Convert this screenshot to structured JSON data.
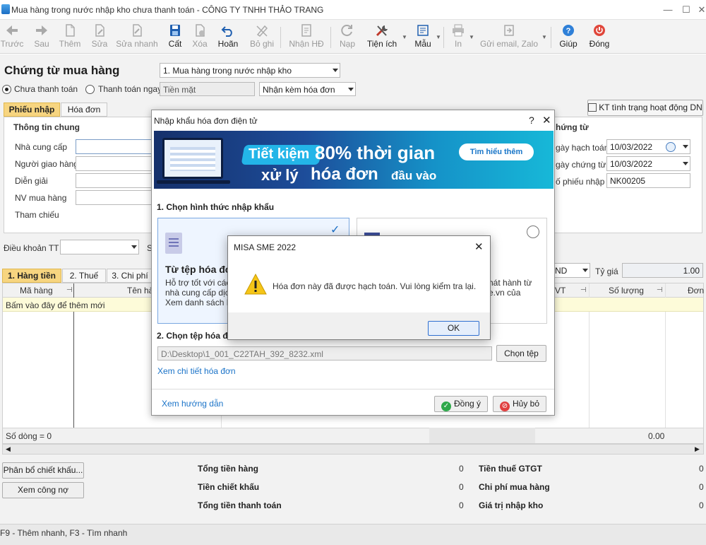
{
  "window": {
    "title": "Mua hàng trong nước nhập kho chưa thanh toán - CÔNG TY TNHH THẢO TRANG"
  },
  "toolbar": {
    "back": "Trước",
    "next": "Sau",
    "add": "Thêm",
    "edit": "Sửa",
    "quick_edit": "Sửa nhanh",
    "save": "Cất",
    "delete": "Xóa",
    "undo": "Hoãn",
    "unpost": "Bỏ ghi",
    "receive_invoice": "Nhận HĐ",
    "load": "Nạp",
    "utilities": "Tiện ích",
    "template": "Mẫu",
    "print": "In",
    "send": "Gửi email, Zalo",
    "help": "Giúp",
    "close": "Đóng"
  },
  "form": {
    "heading": "Chứng từ mua hàng",
    "type_select": "1. Mua hàng trong nước nhập kho",
    "radio_unpaid": "Chưa thanh toán",
    "radio_paid": "Thanh toán ngay",
    "payment_method": "Tiền mặt",
    "invoice_mode": "Nhận kèm hóa đơn",
    "tab_receipt": "Phiếu nhập",
    "tab_invoice": "Hóa đơn",
    "kt_button": "KT tình trạng hoạt động DN",
    "general_info": "Thông tin chung",
    "supplier": "Nhà cung cấp",
    "deliverer": "Người giao hàng",
    "description": "Diễn giải",
    "purchaser": "NV mua hàng",
    "reference": "Tham chiếu",
    "voucher_group": "Chứng từ",
    "voucher_group_visible": "hứng từ",
    "posting_date_label": "gày hạch toán",
    "voucher_date_label": "gày chứng từ",
    "receipt_no_label": "ố phiếu nhập",
    "posting_date": "10/03/2022",
    "voucher_date": "10/03/2022",
    "receipt_no": "NK00205",
    "payment_terms": "Điều khoản TT",
    "payment_terms_suffix": "S",
    "currency_suffix": "ND",
    "exchange_rate_label": "Tỷ giá",
    "exchange_rate": "1.00"
  },
  "grid": {
    "tabs": [
      "1. Hàng tiền",
      "2. Thuế",
      "3. Chi phí"
    ],
    "col_code": "Mã hàng",
    "col_name": "Tên hà",
    "col_unit": "VT",
    "col_qty": "Số lượng",
    "col_price": "Đơn",
    "add_row_hint": "Bấm vào đây để thêm mới",
    "row_count": "Số dòng = 0",
    "footer_total": "0.00"
  },
  "totals": {
    "discount_btn": "Phân bổ chiết khấu...",
    "debt_btn": "Xem công nợ",
    "goods_total": "Tổng tiền hàng",
    "goods_total_val": "0",
    "discount": "Tiền chiết khấu",
    "discount_val": "0",
    "payment_total": "Tổng tiền thanh toán",
    "payment_total_val": "0",
    "vat": "Tiền thuế GTGT",
    "vat_val": "0",
    "purchase_cost": "Chi phí mua hàng",
    "purchase_cost_val": "0",
    "import_value": "Giá trị nhập kho",
    "import_value_val": "0"
  },
  "statusbar": {
    "text": "F9 - Thêm nhanh, F3 - Tìm nhanh"
  },
  "import_dialog": {
    "title": "Nhập khẩu hóa đơn điện tử",
    "help": "?",
    "banner_line1a": "Tiết kiệm",
    "banner_line1b": "80% thời gian",
    "banner_line2a": "xử lý",
    "banner_line2b": "hóa đơn",
    "banner_line2c": "đầu vào",
    "banner_button": "Tìm hiểu thêm",
    "section1": "1. Chọn hình thức nhập khẩu",
    "option1_title": "Từ tệp hóa đơ",
    "option1_line1": "Hỗ trợ tốt với các h",
    "option1_line2": "nhà cung cấp dịch",
    "option1_line3": "Xem danh sách N",
    "option2_line1": "hát hành từ",
    "option2_line2": "e.vn của",
    "section2": "2. Chọn tệp hóa đ",
    "file_path": "D:\\Desktop\\1_001_C22TAH_392_8232.xml",
    "choose_file": "Chọn tệp",
    "view_detail": "Xem chi tiết hóa đơn",
    "guide": "Xem hướng dẫn",
    "ok": "Đồng ý",
    "cancel": "Hủy bỏ"
  },
  "message_box": {
    "title": "MISA SME 2022",
    "message": "Hóa đơn này đã được hạch toán. Vui lòng kiểm tra lại.",
    "ok": "OK"
  },
  "colors": {
    "accent": "#1a73c8",
    "tab_active": "#f7d580",
    "banner_dark": "#15306b",
    "banner_light": "#17b8d8"
  }
}
